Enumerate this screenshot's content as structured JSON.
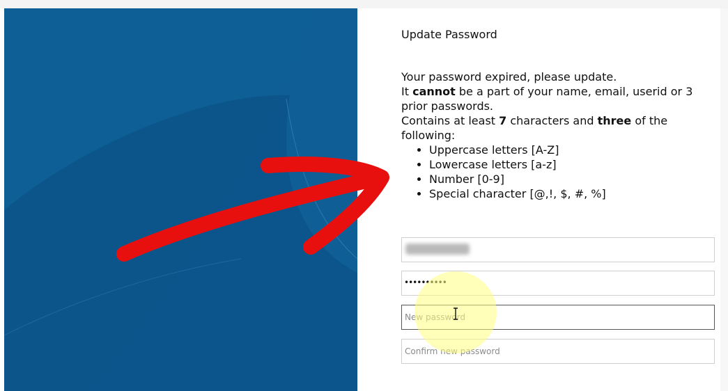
{
  "form": {
    "title": "Update Password",
    "intro": "Your password expired, please update.",
    "rule1_prefix": "It ",
    "rule1_bold": "cannot",
    "rule1_suffix": " be a part of your name, email, userid or 3 prior passwords.",
    "rule2_prefix": "Contains at least ",
    "rule2_bold_count": "7",
    "rule2_middle": " characters and ",
    "rule2_bold_three": "three",
    "rule2_suffix": " of the following:",
    "requirements": [
      "Uppercase letters [A-Z]",
      "Lowercase letters [a-z]",
      "Number [0-9]",
      "Special character [@,!, $, #, %]"
    ],
    "password_mask": "••••••••••",
    "new_password_placeholder": "New password",
    "confirm_password_placeholder": "Confirm new password"
  },
  "colors": {
    "hero_blue": "#0e5f95",
    "annotation_red": "#e8100e",
    "highlight_yellow": "#ffff82"
  },
  "icons": {
    "cursor": "text-cursor-icon",
    "annotation": "red-arrow-annotation"
  }
}
